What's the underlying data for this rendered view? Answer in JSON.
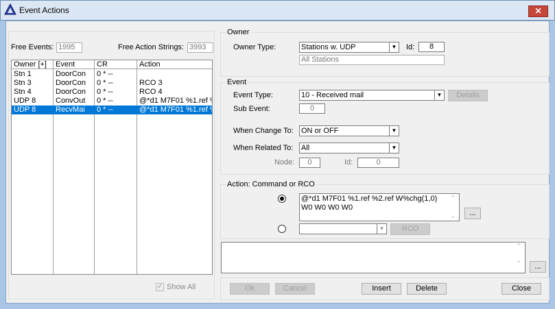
{
  "window": {
    "title": "Event Actions",
    "close": "✕"
  },
  "counts": {
    "free_events_label": "Free Events:",
    "free_events": "1995",
    "free_actions_label": "Free Action Strings:",
    "free_actions": "3993"
  },
  "list": {
    "headers": [
      "Owner [+]",
      "Event",
      "CR",
      "Action"
    ],
    "rows": [
      [
        "Stn 1",
        "DoorCon",
        "0 * --",
        ""
      ],
      [
        "Stn 3",
        "DoorCon",
        "0 * --",
        "RCO 3"
      ],
      [
        "Stn 4",
        "DoorCon",
        "0 * --",
        "RCO 4"
      ],
      [
        "UDP 8",
        "ConvOut",
        "0 * --",
        "@*d1 M7F01 %1.ref %"
      ],
      [
        "UDP 8",
        "RecvMai",
        "0 * --",
        "@*d1 M7F01 %1.ref %"
      ]
    ],
    "selected": 4
  },
  "show_all": "Show All",
  "owner": {
    "group": "Owner",
    "type_label": "Owner Type:",
    "type": "Stations w. UDP",
    "id_label": "Id:",
    "id": "8",
    "desc": "All Stations"
  },
  "event": {
    "group": "Event",
    "type_label": "Event Type:",
    "type": "10 - Received mail",
    "details": "Details",
    "sub_label": "Sub Event:",
    "sub": "0",
    "change_label": "When Change To:",
    "change": "ON or OFF",
    "related_label": "When Related To:",
    "related": "All",
    "node_label": "Node:",
    "node": "0",
    "id_label": "Id:",
    "id": "0"
  },
  "action": {
    "group": "Action: Command or RCO",
    "command": "@*d1 M7F01 %1.ref %2.ref W%chg(1,0) W0 W0 W0 W0",
    "more": "...",
    "rco": "RCO",
    "rco_value": ""
  },
  "comment": {
    "value": "",
    "more": "..."
  },
  "buttons": {
    "ok": "Ok",
    "cancel": "Cancel",
    "insert": "Insert",
    "delete": "Delete",
    "close": "Close"
  }
}
